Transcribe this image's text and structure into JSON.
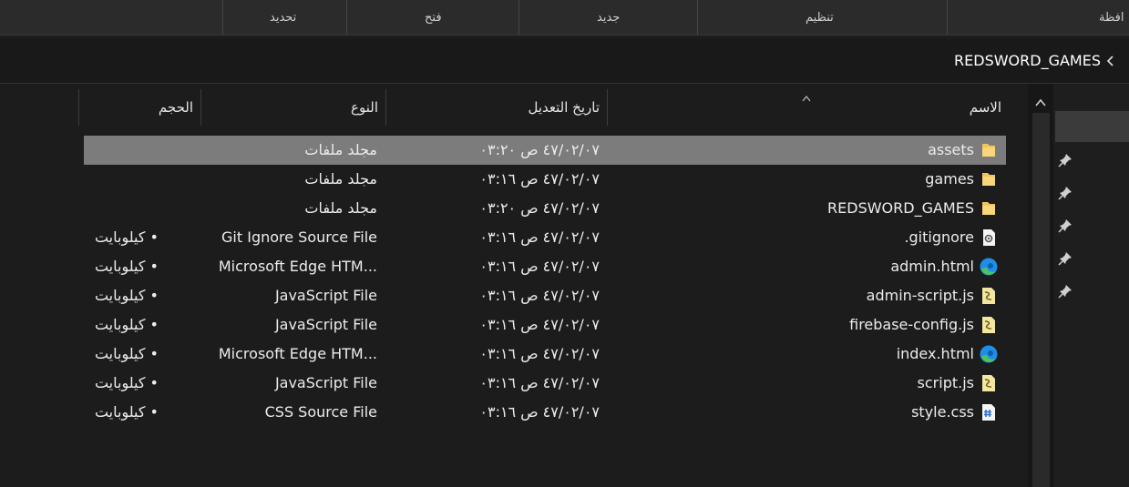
{
  "ribbon": {
    "groups": [
      {
        "label": "تحديد"
      },
      {
        "label": "فتح"
      },
      {
        "label": "جديد"
      },
      {
        "label": "تنظيم"
      },
      {
        "label": "افظة"
      }
    ]
  },
  "address": {
    "path": "REDSWORD_GAMES"
  },
  "columns": {
    "name": "الاسم",
    "date": "تاريخ التعديل",
    "type": "النوع",
    "size": "الحجم"
  },
  "files": [
    {
      "name": "assets",
      "date": "٤٧/٠٢/٠٧ ص ٠٣:٢٠",
      "type": "مجلد ملفات",
      "size": "",
      "icon": "folder-icon",
      "selected": true
    },
    {
      "name": "games",
      "date": "٤٧/٠٢/٠٧ ص ٠٣:١٦",
      "type": "مجلد ملفات",
      "size": "",
      "icon": "folder-icon"
    },
    {
      "name": "REDSWORD_GAMES",
      "date": "٤٧/٠٢/٠٧ ص ٠٣:٢٠",
      "type": "مجلد ملفات",
      "size": "",
      "icon": "folder-icon"
    },
    {
      "name": ".gitignore",
      "date": "٤٧/٠٢/٠٧ ص ٠٣:١٦",
      "type": "Git Ignore Source File",
      "size": "• كيلوبايت",
      "icon": "gear-file-icon"
    },
    {
      "name": "admin.html",
      "date": "٤٧/٠٢/٠٧ ص ٠٣:١٦",
      "type": "Microsoft Edge HTM...",
      "size": "• كيلوبايت",
      "icon": "edge-icon"
    },
    {
      "name": "admin-script.js",
      "date": "٤٧/٠٢/٠٧ ص ٠٣:١٦",
      "type": "JavaScript File",
      "size": "• كيلوبايت",
      "icon": "js-file-icon"
    },
    {
      "name": "firebase-config.js",
      "date": "٤٧/٠٢/٠٧ ص ٠٣:١٦",
      "type": "JavaScript File",
      "size": "• كيلوبايت",
      "icon": "js-file-icon"
    },
    {
      "name": "index.html",
      "date": "٤٧/٠٢/٠٧ ص ٠٣:١٦",
      "type": "Microsoft Edge HTM...",
      "size": "• كيلوبايت",
      "icon": "edge-icon"
    },
    {
      "name": "script.js",
      "date": "٤٧/٠٢/٠٧ ص ٠٣:١٦",
      "type": "JavaScript File",
      "size": "• كيلوبايت",
      "icon": "js-file-icon"
    },
    {
      "name": "style.css",
      "date": "٤٧/٠٢/٠٧ ص ٠٣:١٦",
      "type": "CSS Source File",
      "size": "• كيلوبايت",
      "icon": "css-file-icon"
    }
  ],
  "colors": {
    "selected_row": "#7c7c7c",
    "folder": "#f2c55c",
    "edge_blue": "#1f8ee6",
    "edge_green": "#4fc35b"
  }
}
